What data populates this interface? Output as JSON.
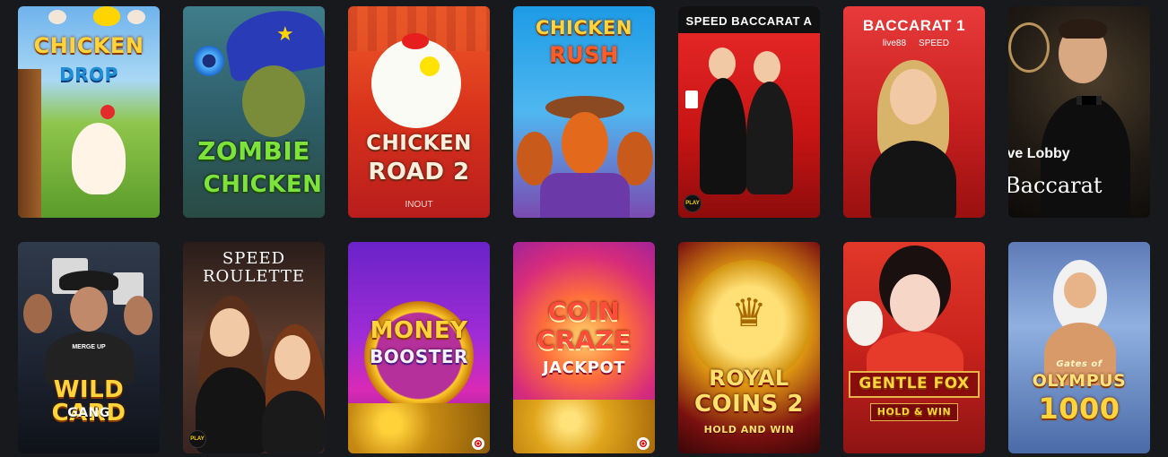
{
  "games": [
    {
      "title_top": "CHICKEN",
      "title_bottom": "DROP"
    },
    {
      "title_top": "ZOMBIE",
      "title_bottom": "CHICKEN"
    },
    {
      "title_top": "CHICKEN",
      "title_bottom": "ROAD 2",
      "provider": "INOUT"
    },
    {
      "title_top": "CHICKEN",
      "title_bottom": "RUSH"
    },
    {
      "title_top": "SPEED BACCARAT A",
      "badge": "PLAY"
    },
    {
      "title_top": "BACCARAT 1",
      "brand": "live88",
      "variant": "SPEED"
    },
    {
      "title_top": "ive Lobby",
      "title_bottom": "Baccarat"
    },
    {
      "title_top": "MERGE UP",
      "title_bottom": "WILD CARD",
      "title_extra": "GANG"
    },
    {
      "title_top": "SPEED",
      "title_bottom": "ROULETTE",
      "badge": "PLAY"
    },
    {
      "title_top": "MONEY",
      "title_bottom": "BOOSTER"
    },
    {
      "title_top": "COIN",
      "title_bottom": "CRAZE",
      "title_extra": "JACKPOT"
    },
    {
      "title_top": "ROYAL",
      "title_bottom": "COINS 2",
      "title_extra": "HOLD AND WIN"
    },
    {
      "title_top": "GENTLE FOX",
      "title_bottom": "HOLD & WIN"
    },
    {
      "title_top": "Gates of",
      "title_bottom": "OLYMPUS",
      "title_extra": "1000"
    }
  ],
  "colors": {
    "background": "#18191d",
    "accent_gold": "#ffd43a"
  }
}
